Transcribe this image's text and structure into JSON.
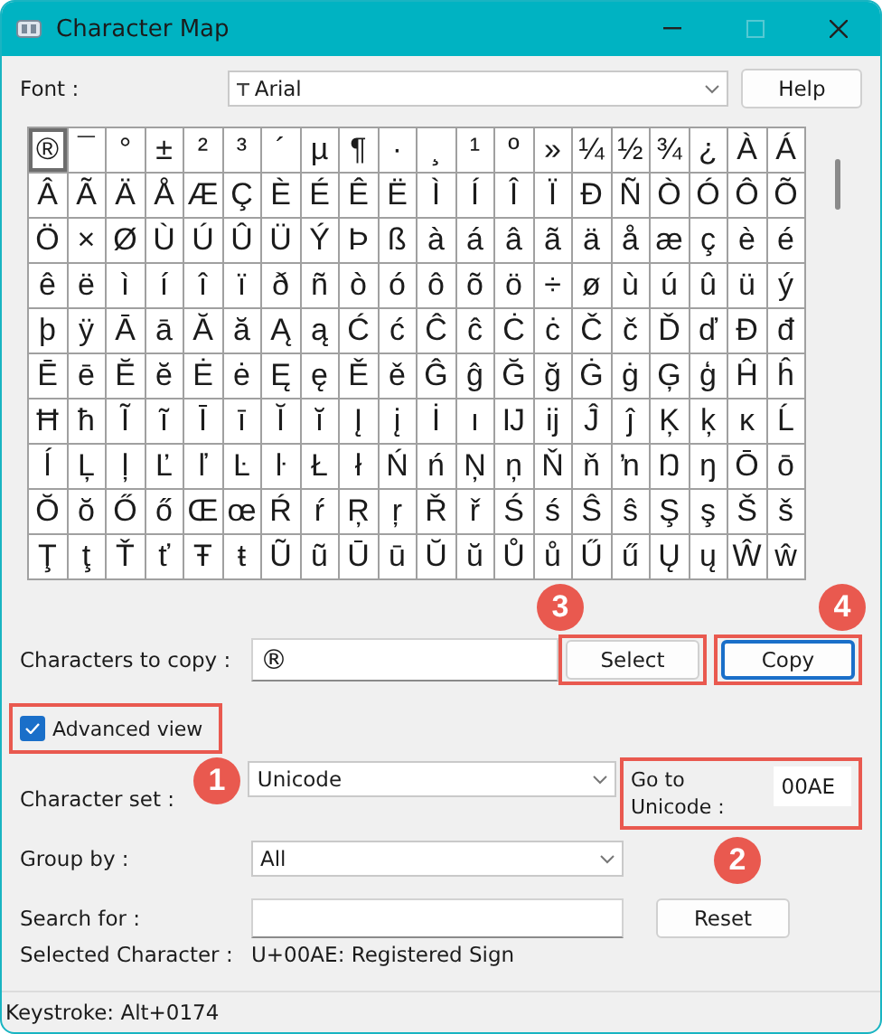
{
  "window": {
    "title": "Character Map",
    "maximize_disabled": true
  },
  "font": {
    "label": "Font :",
    "value": "Arial"
  },
  "help_button": "Help",
  "grid": {
    "rows": [
      [
        {
          "char": "®",
          "selected": true
        },
        {
          "char": "¯",
          "selected": false
        },
        {
          "char": "°",
          "selected": false
        },
        {
          "char": "±",
          "selected": false
        },
        {
          "char": "²",
          "selected": false
        },
        {
          "char": "³",
          "selected": false
        },
        {
          "char": "´",
          "selected": false
        },
        {
          "char": "µ",
          "selected": false
        },
        {
          "char": "¶",
          "selected": false
        },
        {
          "char": "·",
          "selected": false
        },
        {
          "char": "¸",
          "selected": false
        },
        {
          "char": "¹",
          "selected": false
        },
        {
          "char": "º",
          "selected": false
        },
        {
          "char": "»",
          "selected": false
        },
        {
          "char": "¼",
          "selected": false
        },
        {
          "char": "½",
          "selected": false
        },
        {
          "char": "¾",
          "selected": false
        },
        {
          "char": "¿",
          "selected": false
        },
        {
          "char": "À",
          "selected": false
        },
        {
          "char": "Á",
          "selected": false
        }
      ],
      [
        {
          "char": "Â",
          "selected": false
        },
        {
          "char": "Ã",
          "selected": false
        },
        {
          "char": "Ä",
          "selected": false
        },
        {
          "char": "Å",
          "selected": false
        },
        {
          "char": "Æ",
          "selected": false
        },
        {
          "char": "Ç",
          "selected": false
        },
        {
          "char": "È",
          "selected": false
        },
        {
          "char": "É",
          "selected": false
        },
        {
          "char": "Ê",
          "selected": false
        },
        {
          "char": "Ë",
          "selected": false
        },
        {
          "char": "Ì",
          "selected": false
        },
        {
          "char": "Í",
          "selected": false
        },
        {
          "char": "Î",
          "selected": false
        },
        {
          "char": "Ï",
          "selected": false
        },
        {
          "char": "Ð",
          "selected": false
        },
        {
          "char": "Ñ",
          "selected": false
        },
        {
          "char": "Ò",
          "selected": false
        },
        {
          "char": "Ó",
          "selected": false
        },
        {
          "char": "Ô",
          "selected": false
        },
        {
          "char": "Õ",
          "selected": false
        }
      ],
      [
        {
          "char": "Ö",
          "selected": false
        },
        {
          "char": "×",
          "selected": false
        },
        {
          "char": "Ø",
          "selected": false
        },
        {
          "char": "Ù",
          "selected": false
        },
        {
          "char": "Ú",
          "selected": false
        },
        {
          "char": "Û",
          "selected": false
        },
        {
          "char": "Ü",
          "selected": false
        },
        {
          "char": "Ý",
          "selected": false
        },
        {
          "char": "Þ",
          "selected": false
        },
        {
          "char": "ß",
          "selected": false
        },
        {
          "char": "à",
          "selected": false
        },
        {
          "char": "á",
          "selected": false
        },
        {
          "char": "â",
          "selected": false
        },
        {
          "char": "ã",
          "selected": false
        },
        {
          "char": "ä",
          "selected": false
        },
        {
          "char": "å",
          "selected": false
        },
        {
          "char": "æ",
          "selected": false
        },
        {
          "char": "ç",
          "selected": false
        },
        {
          "char": "è",
          "selected": false
        },
        {
          "char": "é",
          "selected": false
        }
      ],
      [
        {
          "char": "ê",
          "selected": false
        },
        {
          "char": "ë",
          "selected": false
        },
        {
          "char": "ì",
          "selected": false
        },
        {
          "char": "í",
          "selected": false
        },
        {
          "char": "î",
          "selected": false
        },
        {
          "char": "ï",
          "selected": false
        },
        {
          "char": "ð",
          "selected": false
        },
        {
          "char": "ñ",
          "selected": false
        },
        {
          "char": "ò",
          "selected": false
        },
        {
          "char": "ó",
          "selected": false
        },
        {
          "char": "ô",
          "selected": false
        },
        {
          "char": "õ",
          "selected": false
        },
        {
          "char": "ö",
          "selected": false
        },
        {
          "char": "÷",
          "selected": false
        },
        {
          "char": "ø",
          "selected": false
        },
        {
          "char": "ù",
          "selected": false
        },
        {
          "char": "ú",
          "selected": false
        },
        {
          "char": "û",
          "selected": false
        },
        {
          "char": "ü",
          "selected": false
        },
        {
          "char": "ý",
          "selected": false
        }
      ],
      [
        {
          "char": "þ",
          "selected": false
        },
        {
          "char": "ÿ",
          "selected": false
        },
        {
          "char": "Ā",
          "selected": false
        },
        {
          "char": "ā",
          "selected": false
        },
        {
          "char": "Ă",
          "selected": false
        },
        {
          "char": "ă",
          "selected": false
        },
        {
          "char": "Ą",
          "selected": false
        },
        {
          "char": "ą",
          "selected": false
        },
        {
          "char": "Ć",
          "selected": false
        },
        {
          "char": "ć",
          "selected": false
        },
        {
          "char": "Ĉ",
          "selected": false
        },
        {
          "char": "ĉ",
          "selected": false
        },
        {
          "char": "Ċ",
          "selected": false
        },
        {
          "char": "ċ",
          "selected": false
        },
        {
          "char": "Č",
          "selected": false
        },
        {
          "char": "č",
          "selected": false
        },
        {
          "char": "Ď",
          "selected": false
        },
        {
          "char": "ď",
          "selected": false
        },
        {
          "char": "Đ",
          "selected": false
        },
        {
          "char": "đ",
          "selected": false
        }
      ],
      [
        {
          "char": "Ē",
          "selected": false
        },
        {
          "char": "ē",
          "selected": false
        },
        {
          "char": "Ĕ",
          "selected": false
        },
        {
          "char": "ĕ",
          "selected": false
        },
        {
          "char": "Ė",
          "selected": false
        },
        {
          "char": "ė",
          "selected": false
        },
        {
          "char": "Ę",
          "selected": false
        },
        {
          "char": "ę",
          "selected": false
        },
        {
          "char": "Ě",
          "selected": false
        },
        {
          "char": "ě",
          "selected": false
        },
        {
          "char": "Ĝ",
          "selected": false
        },
        {
          "char": "ĝ",
          "selected": false
        },
        {
          "char": "Ğ",
          "selected": false
        },
        {
          "char": "ğ",
          "selected": false
        },
        {
          "char": "Ġ",
          "selected": false
        },
        {
          "char": "ġ",
          "selected": false
        },
        {
          "char": "Ģ",
          "selected": false
        },
        {
          "char": "ģ",
          "selected": false
        },
        {
          "char": "Ĥ",
          "selected": false
        },
        {
          "char": "ĥ",
          "selected": false
        }
      ],
      [
        {
          "char": "Ħ",
          "selected": false
        },
        {
          "char": "ħ",
          "selected": false
        },
        {
          "char": "Ĩ",
          "selected": false
        },
        {
          "char": "ĩ",
          "selected": false
        },
        {
          "char": "Ī",
          "selected": false
        },
        {
          "char": "ī",
          "selected": false
        },
        {
          "char": "Ĭ",
          "selected": false
        },
        {
          "char": "ĭ",
          "selected": false
        },
        {
          "char": "Į",
          "selected": false
        },
        {
          "char": "į",
          "selected": false
        },
        {
          "char": "İ",
          "selected": false
        },
        {
          "char": "ı",
          "selected": false
        },
        {
          "char": "Ĳ",
          "selected": false
        },
        {
          "char": "ĳ",
          "selected": false
        },
        {
          "char": "Ĵ",
          "selected": false
        },
        {
          "char": "ĵ",
          "selected": false
        },
        {
          "char": "Ķ",
          "selected": false
        },
        {
          "char": "ķ",
          "selected": false
        },
        {
          "char": "ĸ",
          "selected": false
        },
        {
          "char": "Ĺ",
          "selected": false
        }
      ],
      [
        {
          "char": "ĺ",
          "selected": false
        },
        {
          "char": "Ļ",
          "selected": false
        },
        {
          "char": "ļ",
          "selected": false
        },
        {
          "char": "Ľ",
          "selected": false
        },
        {
          "char": "ľ",
          "selected": false
        },
        {
          "char": "Ŀ",
          "selected": false
        },
        {
          "char": "ŀ",
          "selected": false
        },
        {
          "char": "Ł",
          "selected": false
        },
        {
          "char": "ł",
          "selected": false
        },
        {
          "char": "Ń",
          "selected": false
        },
        {
          "char": "ń",
          "selected": false
        },
        {
          "char": "Ņ",
          "selected": false
        },
        {
          "char": "ņ",
          "selected": false
        },
        {
          "char": "Ň",
          "selected": false
        },
        {
          "char": "ň",
          "selected": false
        },
        {
          "char": "ŉ",
          "selected": false
        },
        {
          "char": "Ŋ",
          "selected": false
        },
        {
          "char": "ŋ",
          "selected": false
        },
        {
          "char": "Ō",
          "selected": false
        },
        {
          "char": "ō",
          "selected": false
        }
      ],
      [
        {
          "char": "Ŏ",
          "selected": false
        },
        {
          "char": "ŏ",
          "selected": false
        },
        {
          "char": "Ő",
          "selected": false
        },
        {
          "char": "ő",
          "selected": false
        },
        {
          "char": "Œ",
          "selected": false
        },
        {
          "char": "œ",
          "selected": false
        },
        {
          "char": "Ŕ",
          "selected": false
        },
        {
          "char": "ŕ",
          "selected": false
        },
        {
          "char": "Ŗ",
          "selected": false
        },
        {
          "char": "ŗ",
          "selected": false
        },
        {
          "char": "Ř",
          "selected": false
        },
        {
          "char": "ř",
          "selected": false
        },
        {
          "char": "Ś",
          "selected": false
        },
        {
          "char": "ś",
          "selected": false
        },
        {
          "char": "Ŝ",
          "selected": false
        },
        {
          "char": "ŝ",
          "selected": false
        },
        {
          "char": "Ş",
          "selected": false
        },
        {
          "char": "ş",
          "selected": false
        },
        {
          "char": "Š",
          "selected": false
        },
        {
          "char": "š",
          "selected": false
        }
      ],
      [
        {
          "char": "Ţ",
          "selected": false
        },
        {
          "char": "ţ",
          "selected": false
        },
        {
          "char": "Ť",
          "selected": false
        },
        {
          "char": "ť",
          "selected": false
        },
        {
          "char": "Ŧ",
          "selected": false
        },
        {
          "char": "ŧ",
          "selected": false
        },
        {
          "char": "Ũ",
          "selected": false
        },
        {
          "char": "ũ",
          "selected": false
        },
        {
          "char": "Ū",
          "selected": false
        },
        {
          "char": "ū",
          "selected": false
        },
        {
          "char": "Ŭ",
          "selected": false
        },
        {
          "char": "ŭ",
          "selected": false
        },
        {
          "char": "Ů",
          "selected": false
        },
        {
          "char": "ů",
          "selected": false
        },
        {
          "char": "Ű",
          "selected": false
        },
        {
          "char": "ű",
          "selected": false
        },
        {
          "char": "Ų",
          "selected": false
        },
        {
          "char": "ų",
          "selected": false
        },
        {
          "char": "Ŵ",
          "selected": false
        },
        {
          "char": "ŵ",
          "selected": false
        }
      ]
    ]
  },
  "copy": {
    "label": "Characters to copy :",
    "value": "®"
  },
  "select_button": "Select",
  "copy_button": "Copy",
  "advanced_view": {
    "label": "Advanced view",
    "checked": true
  },
  "character_set": {
    "label": "Character set :",
    "value": "Unicode"
  },
  "go_to_unicode": {
    "label": "Go to Unicode :",
    "value": "00AE"
  },
  "group_by": {
    "label": "Group by :",
    "value": "All"
  },
  "search": {
    "label": "Search for :"
  },
  "reset_button": "Reset",
  "selected_character": {
    "label": "Selected Character :",
    "value": "U+00AE: Registered Sign"
  },
  "status_bar": "Keystroke: Alt+0174",
  "annotations": [
    "1",
    "2",
    "3",
    "4"
  ]
}
